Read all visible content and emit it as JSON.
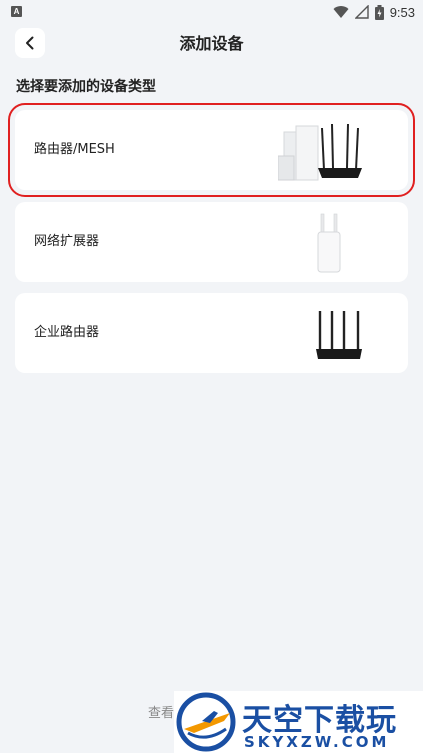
{
  "status_bar": {
    "app_icon_letter": "A",
    "time": "9:53"
  },
  "header": {
    "title": "添加设备"
  },
  "section_title": "选择要添加的设备类型",
  "devices": [
    {
      "name": "路由器/MESH",
      "icon": "mesh-router-icon",
      "selected": true
    },
    {
      "name": "网络扩展器",
      "icon": "range-extender-icon",
      "selected": false
    },
    {
      "name": "企业路由器",
      "icon": "enterprise-router-icon",
      "selected": false
    }
  ],
  "footer": {
    "link_text": "查看"
  },
  "watermark": {
    "cn_text": "天空下载玩",
    "domain_text": "SKYXZW.COM"
  },
  "colors": {
    "background": "#f2f4f7",
    "card": "#ffffff",
    "highlight": "#e02020",
    "watermark_blue": "#1a4fa3",
    "watermark_orange": "#f39800"
  }
}
